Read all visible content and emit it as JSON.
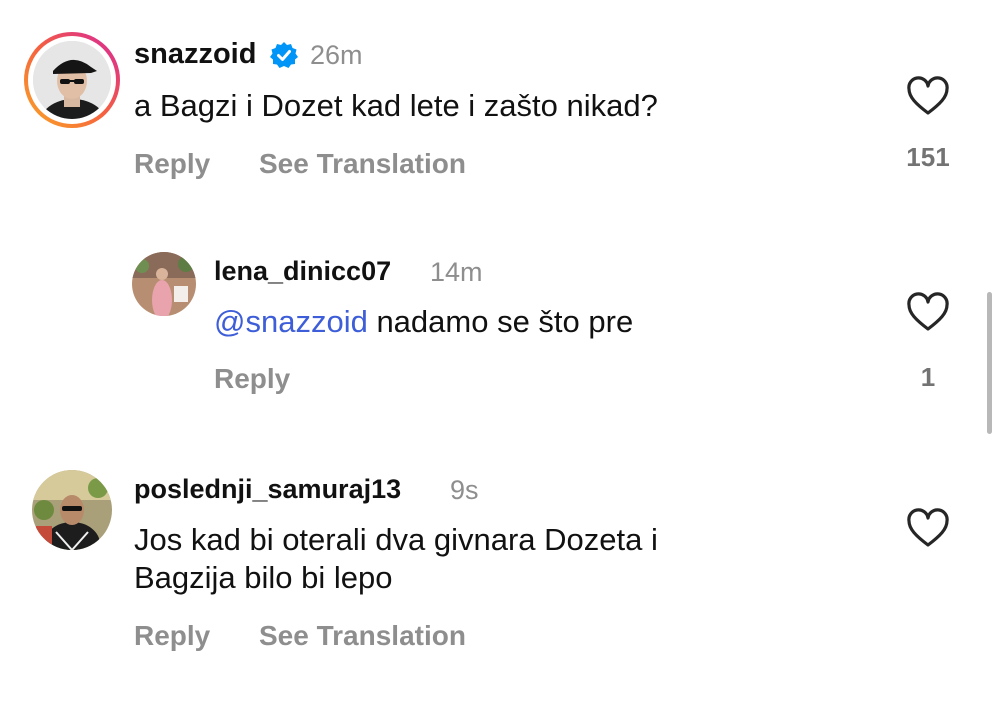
{
  "comments": [
    {
      "username": "snazzoid",
      "verified": true,
      "time": "26m",
      "text": "a Bagzi i Dozet kad lete i zašto nikad?",
      "actions": {
        "reply": "Reply",
        "translate": "See Translation"
      },
      "likes": "151"
    },
    {
      "username": "lena_dinicc07",
      "time": "14m",
      "mention": "@snazzoid",
      "text": " nadamo se što pre",
      "actions": {
        "reply": "Reply"
      },
      "likes": "1"
    },
    {
      "username": "poslednji_samuraj13",
      "time": "9s",
      "text_lines": [
        "Jos kad bi oterali dva givnara Dozeta i",
        "Bagzija bilo bi lepo"
      ],
      "actions": {
        "reply": "Reply",
        "translate": "See Translation"
      }
    }
  ],
  "colors": {
    "story_ring_start": "#f9a825",
    "story_ring_end": "#d6249f",
    "verified": "#0095f6",
    "mention": "#3d5ed8",
    "muted": "#8e8e8e"
  },
  "icons": {
    "like": "heart-outline-icon",
    "verified": "verified-badge-icon"
  }
}
